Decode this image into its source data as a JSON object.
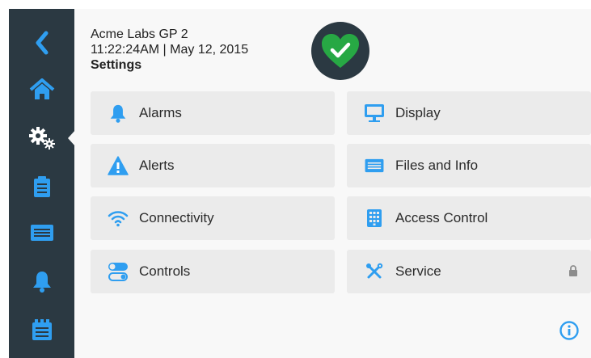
{
  "header": {
    "device_name": "Acme Labs GP 2",
    "datetime": "11:22:24AM | May 12, 2015",
    "page_title": "Settings"
  },
  "status": {
    "icon": "heart-check-icon",
    "state_color": "#27a844"
  },
  "sidebar": {
    "items": [
      {
        "name": "back",
        "icon": "chevron-left-icon"
      },
      {
        "name": "home",
        "icon": "home-icon"
      },
      {
        "name": "settings",
        "icon": "gears-icon",
        "active": true
      },
      {
        "name": "clipboard",
        "icon": "clipboard-icon"
      },
      {
        "name": "files",
        "icon": "files-icon"
      },
      {
        "name": "alarms",
        "icon": "bell-icon"
      },
      {
        "name": "calendar",
        "icon": "calendar-icon"
      }
    ]
  },
  "tiles": [
    {
      "label": "Alarms",
      "icon": "bell-icon"
    },
    {
      "label": "Display",
      "icon": "monitor-icon"
    },
    {
      "label": "Alerts",
      "icon": "warning-icon"
    },
    {
      "label": "Files and Info",
      "icon": "files-icon"
    },
    {
      "label": "Connectivity",
      "icon": "wifi-icon"
    },
    {
      "label": "Access Control",
      "icon": "keypad-icon"
    },
    {
      "label": "Controls",
      "icon": "toggles-icon"
    },
    {
      "label": "Service",
      "icon": "tools-icon",
      "locked": true
    }
  ],
  "colors": {
    "accent": "#2f9ef0",
    "sidebar": "#2b3942",
    "tile": "#ebebeb"
  }
}
